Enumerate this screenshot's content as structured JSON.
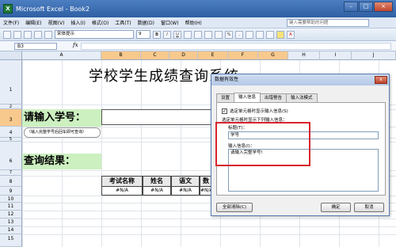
{
  "window": {
    "title": "Microsoft Excel - Book2",
    "app_icon_glyph": "X"
  },
  "menu": {
    "items": [
      "文件(F)",
      "编辑(E)",
      "视图(V)",
      "插入(I)",
      "格式(O)",
      "工具(T)",
      "数据(D)",
      "窗口(W)",
      "帮助(H)"
    ],
    "help_placeholder": "键入需要帮助的问题"
  },
  "toolbar": {
    "font": "宋体提示",
    "size": "9"
  },
  "formula": {
    "name_box": "B3",
    "fx": "fx"
  },
  "grid": {
    "columns": [
      "A",
      "B",
      "C",
      "D",
      "E",
      "F",
      "G",
      "H",
      "I",
      "J"
    ],
    "selected_columns": [
      "B",
      "C",
      "D",
      "E",
      "F",
      "G"
    ],
    "rows": [
      "1",
      "2",
      "3",
      "4",
      "5",
      "6",
      "7",
      "8",
      "9",
      "10",
      "11",
      "12",
      "13",
      "14",
      "15"
    ],
    "selected_row": "3"
  },
  "sheet": {
    "title": "学校学生成绩查询系统",
    "input_label": "请输入学号：",
    "hint": "（输入完整学号后回车即可查询）",
    "result_label": "查询结果：",
    "table_headers": [
      "考试名称",
      "姓名",
      "语文",
      "数"
    ],
    "table_values": [
      "#N/A",
      "#N/A",
      "#N/A",
      "#N/A"
    ]
  },
  "dialog": {
    "title": "数据有效性",
    "close_glyph": "x",
    "tabs": [
      "设置",
      "输入信息",
      "出错警告",
      "输入法模式"
    ],
    "active_tab": "输入信息",
    "show_checkbox": "选定单元格时显示输入信息(S)",
    "section": "选定单元格时显示下列输入信息：",
    "title_label": "标题(T)：",
    "title_value": "学号",
    "message_label": "输入信息(I)：",
    "message_value": "请输入完整学号!",
    "clear_button": "全部清除(C)",
    "ok_button": "确定",
    "cancel_button": "取消"
  }
}
